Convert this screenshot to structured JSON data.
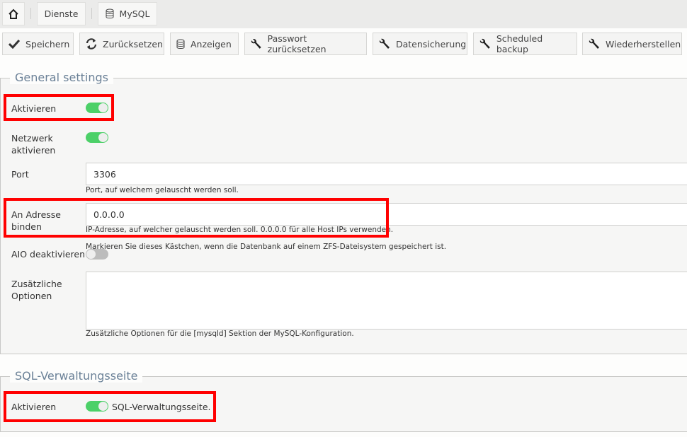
{
  "breadcrumb": {
    "home_icon": "home-icon",
    "items": [
      {
        "label": "Dienste"
      },
      {
        "label": "MySQL",
        "icon": "database-icon"
      }
    ]
  },
  "toolbar": [
    {
      "label": "Speichern",
      "icon": "checkmark-icon"
    },
    {
      "label": "Zurücksetzen",
      "icon": "refresh-icon"
    },
    {
      "label": "Anzeigen",
      "icon": "database-icon"
    },
    {
      "label": "Passwort zurücksetzen",
      "icon": "wrench-icon"
    },
    {
      "label": "Datensicherung",
      "icon": "wrench-icon"
    },
    {
      "label": "Scheduled backup",
      "icon": "wrench-icon"
    },
    {
      "label": "Wiederherstellen",
      "icon": "wrench-icon"
    }
  ],
  "general": {
    "legend": "General settings",
    "enable": {
      "label": "Aktivieren",
      "on": true
    },
    "network": {
      "label": "Netzwerk aktivieren",
      "on": true
    },
    "port": {
      "label": "Port",
      "value": "3306",
      "help": "Port, auf welchem gelauscht werden soll."
    },
    "bind": {
      "label": "An Adresse binden",
      "value": "0.0.0.0",
      "help": "IP-Adresse, auf welcher gelauscht werden soll. 0.0.0.0 für alle Host IPs verwenden."
    },
    "aio": {
      "label": "AIO deaktivieren",
      "on": false,
      "help": "Markieren Sie dieses Kästchen, wenn die Datenbank auf einem ZFS-Dateisystem gespeichert ist."
    },
    "extra": {
      "label": "Zusätzliche Optionen",
      "value": "",
      "help": "Zusätzliche Optionen für die [mysqld] Sektion der MySQL-Konfiguration."
    }
  },
  "sql": {
    "legend": "SQL-Verwaltungsseite",
    "enable": {
      "label": "Aktivieren",
      "on": true,
      "text": "SQL-Verwaltungsseite."
    }
  },
  "colors": {
    "toggle_on": "#4cd068",
    "highlight": "#ff0000"
  }
}
